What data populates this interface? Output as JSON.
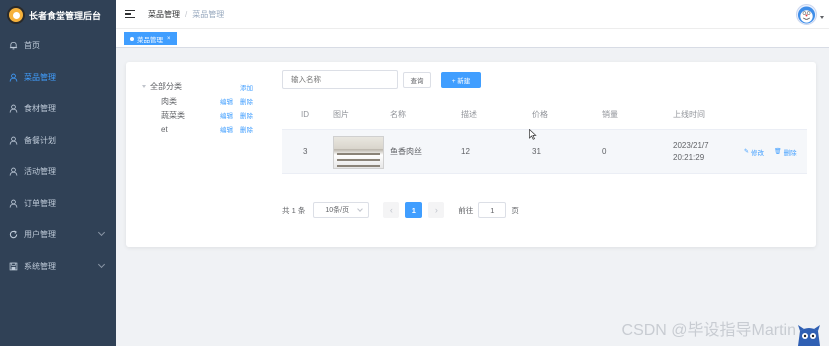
{
  "app": {
    "title": "长者食堂管理后台"
  },
  "sidebar": {
    "items": [
      {
        "label": "首页",
        "icon": "bell-icon",
        "active": false,
        "expandable": false
      },
      {
        "label": "菜品管理",
        "icon": "user-icon",
        "active": true,
        "expandable": false
      },
      {
        "label": "食材管理",
        "icon": "user-icon",
        "active": false,
        "expandable": false
      },
      {
        "label": "备餐计划",
        "icon": "user-icon",
        "active": false,
        "expandable": false
      },
      {
        "label": "活动管理",
        "icon": "user-icon",
        "active": false,
        "expandable": false
      },
      {
        "label": "订单管理",
        "icon": "user-icon",
        "active": false,
        "expandable": false
      },
      {
        "label": "用户管理",
        "icon": "refresh-icon",
        "active": false,
        "expandable": true
      },
      {
        "label": "系统管理",
        "icon": "save-icon",
        "active": false,
        "expandable": true
      }
    ]
  },
  "header": {
    "breadcrumb": [
      "菜品管理",
      "菜品管理"
    ],
    "separator": "/"
  },
  "tags": [
    {
      "label": "菜品管理",
      "close": "×"
    }
  ],
  "tree": {
    "root": {
      "label": "全部分类",
      "add": "添加"
    },
    "children": [
      {
        "label": "肉类",
        "edit": "编辑",
        "delete": "删除"
      },
      {
        "label": "蔬菜类",
        "edit": "编辑",
        "delete": "删除"
      },
      {
        "label": "et",
        "edit": "编辑",
        "delete": "删除"
      }
    ]
  },
  "toolbar": {
    "search_placeholder": "输入名称",
    "query_label": "查询",
    "add_label": "+ 新建"
  },
  "table": {
    "columns": [
      "ID",
      "图片",
      "名称",
      "描述",
      "价格",
      "销量",
      "上线时间"
    ],
    "rows": [
      {
        "id": "3",
        "name": "鱼香肉丝",
        "desc": "12",
        "price": "31",
        "sales": "0",
        "time": "2023/21/7 20:21:29",
        "edit": "修改",
        "delete": "删除"
      }
    ]
  },
  "pagination": {
    "total": "共 1 条",
    "page_size": "10条/页",
    "current": "1",
    "goto_label": "前往",
    "goto_value": "1",
    "page_unit": "页"
  },
  "watermark": "CSDN @毕设指导Martin",
  "colors": {
    "primary": "#409eff",
    "sidebar": "#304156",
    "sidebar_text": "#bfcbd9",
    "background": "#f0f2f5"
  }
}
